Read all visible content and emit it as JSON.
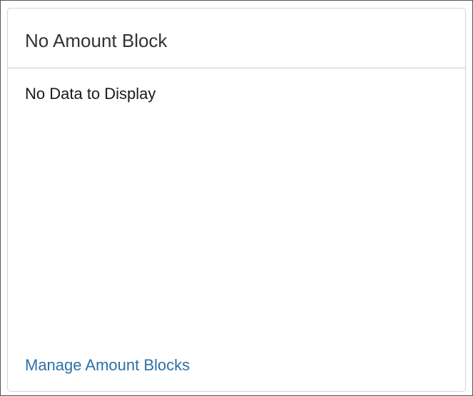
{
  "card": {
    "title": "No Amount Block",
    "empty_message": "No Data to Display",
    "manage_link_label": "Manage Amount Blocks"
  },
  "colors": {
    "link": "#2f6fa3",
    "title_text": "#333333",
    "border": "#d6d6d6"
  }
}
